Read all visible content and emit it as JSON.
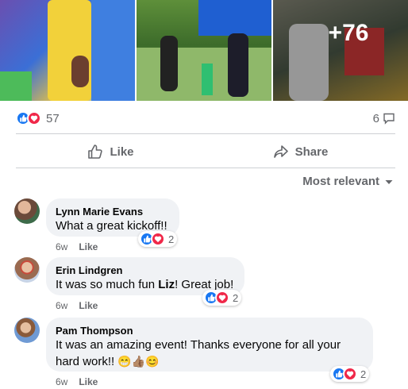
{
  "photos": {
    "more_count": "+76"
  },
  "summary": {
    "reaction_count": "57",
    "comment_count": "6"
  },
  "actions": {
    "like_label": "Like",
    "share_label": "Share"
  },
  "sort": {
    "label": "Most relevant"
  },
  "comments": [
    {
      "author": "Lynn Marie Evans",
      "text": "What a great kickoff!!",
      "age": "6w",
      "like_label": "Like",
      "reaction_count": "2"
    },
    {
      "author": "Erin Lindgren",
      "text_before": "It was so much fun ",
      "mention": "Liz",
      "text_after": "! Great job!",
      "age": "6w",
      "like_label": "Like",
      "reaction_count": "2"
    },
    {
      "author": "Pam Thompson",
      "text_line1": "It was an amazing event! Thanks everyone for all your",
      "text_line2": "hard work!!",
      "emojis": "😁👍🏽😊",
      "age": "6w",
      "like_label": "Like",
      "reaction_count": "2"
    }
  ],
  "colors": {
    "like_blue": "#1877f2",
    "love_red": "#f02849",
    "secondary_text": "#65676b",
    "bubble_bg": "#f0f2f5"
  },
  "icons": [
    "like-reaction-icon",
    "love-reaction-icon",
    "comment-icon",
    "thumbs-up-icon",
    "share-arrow-icon",
    "caret-down-icon"
  ]
}
